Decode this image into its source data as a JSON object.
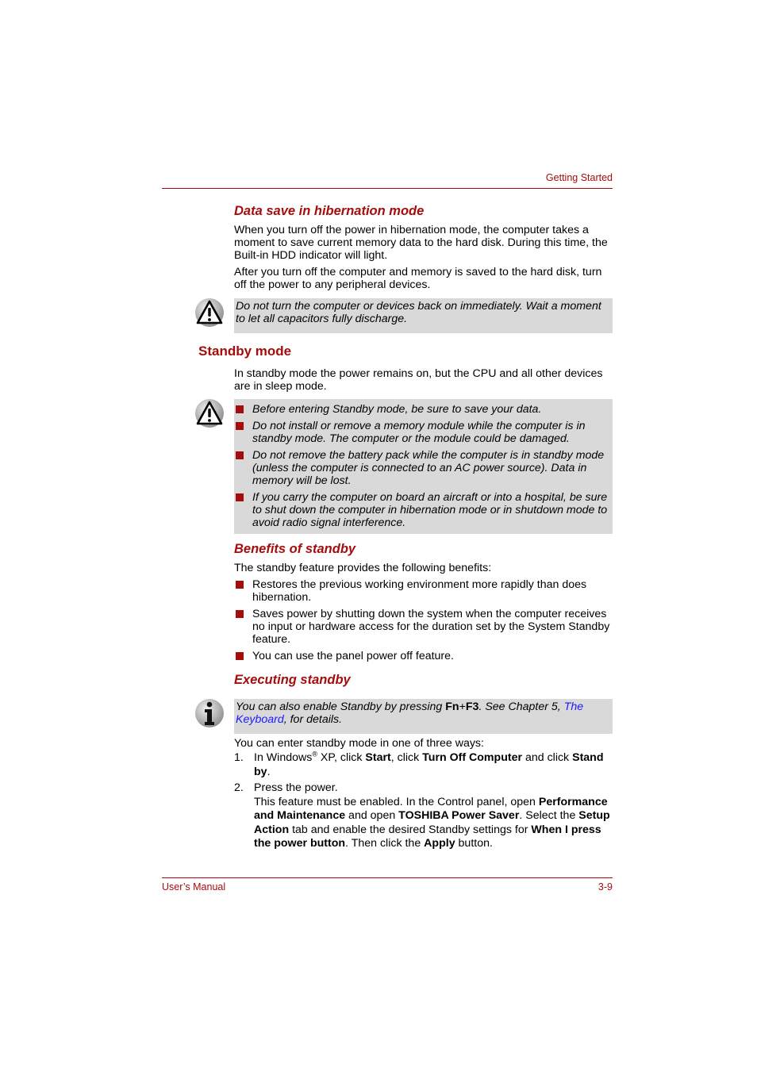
{
  "header": {
    "section": "Getting Started"
  },
  "sections": {
    "hibernation": {
      "title": "Data save in hibernation mode",
      "p1": "When you turn off the power in hibernation mode, the computer takes a moment to save current memory data to the hard disk. During this time, the Built-in HDD indicator will light.",
      "p2": "After you turn off the computer and memory is saved to the hard disk, turn off the power to any peripheral devices.",
      "caution": "Do not turn the computer or devices back on immediately. Wait a moment to let all capacitors fully discharge.",
      "caution_icon": "warning-triangle-icon"
    },
    "standby": {
      "title": "Standby mode",
      "p1": "In standby mode the power remains on, but the CPU and all other devices are in sleep mode.",
      "caution_icon": "warning-triangle-icon",
      "cautions": [
        "Before entering Standby mode, be sure to save your data.",
        "Do not install or remove a memory module while the computer is in standby mode. The computer or the module could be damaged.",
        "Do not remove the battery pack while the computer is in standby mode (unless the computer is connected to an AC power source). Data in memory will be lost.",
        "If you carry the computer on board an aircraft or into a hospital, be sure to shut down the computer in hibernation mode or in shutdown mode to avoid radio signal interference."
      ]
    },
    "benefits": {
      "title": "Benefits of standby",
      "intro": "The standby feature provides the following benefits:",
      "items": [
        "Restores the previous working environment more rapidly than does hibernation.",
        "Saves power by shutting down the system when the computer receives no input or hardware access for the duration set by the System Standby feature.",
        "You can use the panel power off feature."
      ]
    },
    "executing": {
      "title": "Executing standby",
      "note_icon": "information-icon",
      "note": {
        "t1": "You can also enable Standby by pressing ",
        "key1": "Fn",
        "plus": "+",
        "key2": "F3",
        "t2": ". See Chapter 5, ",
        "link": "The Keyboard",
        "t3": ", for details."
      },
      "intro": "You can enter standby mode in one of three ways:",
      "steps": [
        {
          "num": "1.",
          "a": "In Windows",
          "reg": "®",
          "b": " XP, click ",
          "start": "Start",
          "c": ", click ",
          "turnoff": "Turn Off Computer",
          "d": " and click ",
          "standby": "Stand by",
          "e": "."
        },
        {
          "num": "2.",
          "line1": "Press the power.",
          "a": "This feature must be enabled. In the Control panel, open ",
          "perf": "Performance and Maintenance",
          "b": " and open ",
          "saver": "TOSHIBA Power Saver",
          "c": ". Select the ",
          "setup": "Setup Action",
          "d": " tab and enable the desired Standby settings for ",
          "when": "When I press the power button",
          "e": ". Then click the ",
          "apply": "Apply",
          "f": " button."
        }
      ]
    }
  },
  "footer": {
    "left": "User’s Manual",
    "right": "3-9"
  }
}
